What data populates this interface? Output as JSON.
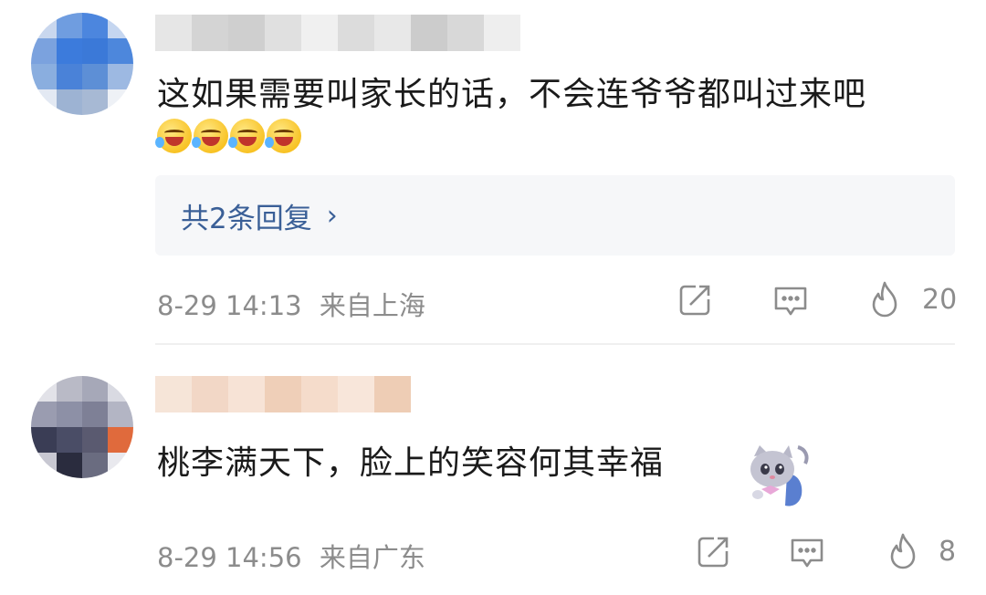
{
  "comments": [
    {
      "text": "这如果需要叫家长的话，不会连爷爷都叫过来吧",
      "emojis": [
        "laugh-cry-emoji",
        "laugh-cry-emoji",
        "tears-emoji",
        "tears-emoji"
      ],
      "replies_label": "共2条回复",
      "replies_chevron": "›",
      "date": "8-29 14:13",
      "location": "来自上海",
      "like_count": "20"
    },
    {
      "text": "桃李满天下，脸上的笑容何其幸福",
      "sticker": "cat-sticker",
      "date": "8-29 14:56",
      "location": "来自广东",
      "like_count": "8"
    }
  ],
  "colors": {
    "text": "#1a1a1a",
    "meta": "#8c8c8c",
    "link": "#3a5f97",
    "reply_bg": "#f6f7f9"
  }
}
